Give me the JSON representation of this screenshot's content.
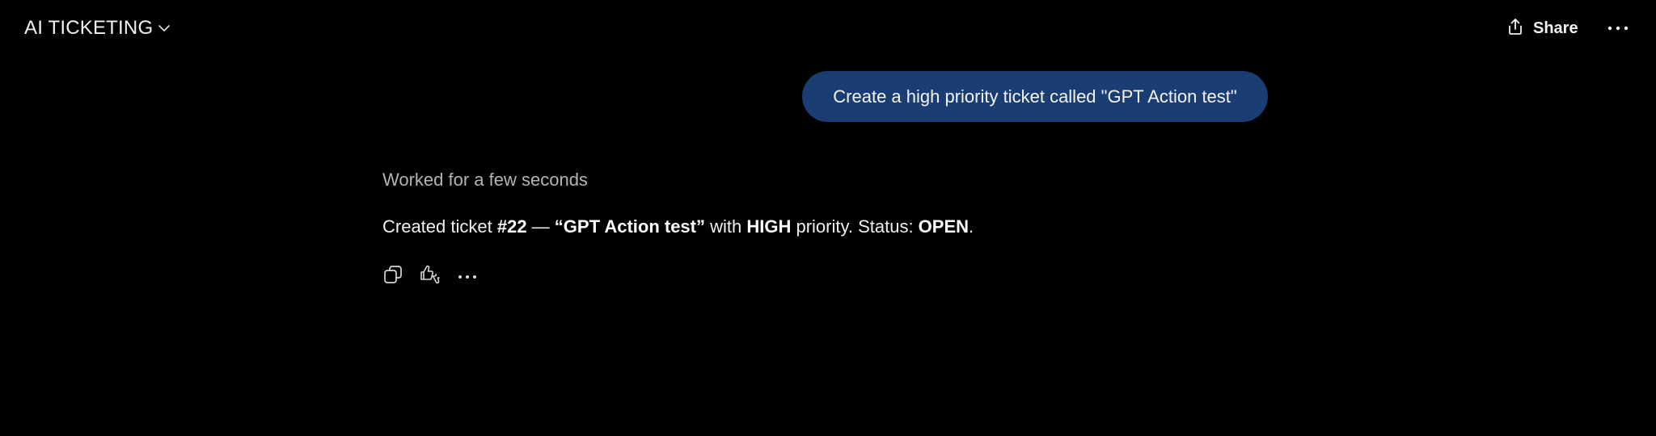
{
  "header": {
    "model_title": "AI TICKETING",
    "share_label": "Share"
  },
  "conversation": {
    "user_message": "Create a high priority ticket called \"GPT Action test\"",
    "worked_status": "Worked for a few seconds",
    "assistant_message": {
      "prefix": "Created ticket ",
      "ticket_number": "#22",
      "dash": " — ",
      "ticket_title": "“GPT Action test”",
      "with_text": " with ",
      "priority": "HIGH",
      "priority_suffix": " priority. Status: ",
      "status": "OPEN",
      "end": "."
    }
  },
  "icons": {
    "model_dropdown": "chevron-down-icon",
    "share": "share-icon",
    "more": "more-horizontal-icon",
    "copy": "copy-icon",
    "feedback": "thumbs-icon",
    "message_more": "more-horizontal-icon"
  },
  "colors": {
    "background": "#000000",
    "user_bubble": "#1a3d73",
    "text_primary": "#f0f0f0",
    "text_muted": "#b4b4b4"
  }
}
